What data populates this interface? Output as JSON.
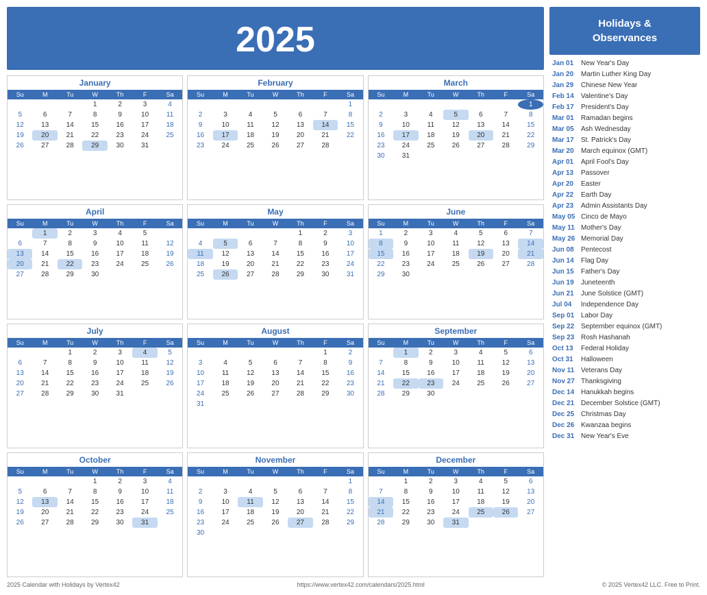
{
  "year": "2025",
  "footer": {
    "left": "2025 Calendar with Holidays by Vertex42",
    "center": "https://www.vertex42.com/calendars/2025.html",
    "right": "© 2025 Vertex42 LLC. Free to Print."
  },
  "holidays_title": "Holidays &\nObservances",
  "holidays": [
    {
      "date": "Jan 01",
      "name": "New Year's Day"
    },
    {
      "date": "Jan 20",
      "name": "Martin Luther King Day"
    },
    {
      "date": "Jan 29",
      "name": "Chinese New Year"
    },
    {
      "date": "Feb 14",
      "name": "Valentine's Day"
    },
    {
      "date": "Feb 17",
      "name": "President's Day"
    },
    {
      "date": "Mar 01",
      "name": "Ramadan begins"
    },
    {
      "date": "Mar 05",
      "name": "Ash Wednesday"
    },
    {
      "date": "Mar 17",
      "name": "St. Patrick's Day"
    },
    {
      "date": "Mar 20",
      "name": "March equinox (GMT)"
    },
    {
      "date": "Apr 01",
      "name": "April Fool's Day"
    },
    {
      "date": "Apr 13",
      "name": "Passover"
    },
    {
      "date": "Apr 20",
      "name": "Easter"
    },
    {
      "date": "Apr 22",
      "name": "Earth Day"
    },
    {
      "date": "Apr 23",
      "name": "Admin Assistants Day"
    },
    {
      "date": "May 05",
      "name": "Cinco de Mayo"
    },
    {
      "date": "May 11",
      "name": "Mother's Day"
    },
    {
      "date": "May 26",
      "name": "Memorial Day"
    },
    {
      "date": "Jun 08",
      "name": "Pentecost"
    },
    {
      "date": "Jun 14",
      "name": "Flag Day"
    },
    {
      "date": "Jun 15",
      "name": "Father's Day"
    },
    {
      "date": "Jun 19",
      "name": "Juneteenth"
    },
    {
      "date": "Jun 21",
      "name": "June Solstice (GMT)"
    },
    {
      "date": "Jul 04",
      "name": "Independence Day"
    },
    {
      "date": "Sep 01",
      "name": "Labor Day"
    },
    {
      "date": "Sep 22",
      "name": "September equinox (GMT)"
    },
    {
      "date": "Sep 23",
      "name": "Rosh Hashanah"
    },
    {
      "date": "Oct 13",
      "name": "Federal Holiday"
    },
    {
      "date": "Oct 31",
      "name": "Halloween"
    },
    {
      "date": "Nov 11",
      "name": "Veterans Day"
    },
    {
      "date": "Nov 27",
      "name": "Thanksgiving"
    },
    {
      "date": "Dec 14",
      "name": "Hanukkah begins"
    },
    {
      "date": "Dec 21",
      "name": "December Solstice (GMT)"
    },
    {
      "date": "Dec 25",
      "name": "Christmas Day"
    },
    {
      "date": "Dec 26",
      "name": "Kwanzaa begins"
    },
    {
      "date": "Dec 31",
      "name": "New Year's Eve"
    }
  ],
  "months": [
    {
      "name": "January",
      "weeks": [
        [
          "",
          "",
          "",
          "1",
          "2",
          "3",
          "4"
        ],
        [
          "5",
          "6",
          "7",
          "8",
          "9",
          "10",
          "11"
        ],
        [
          "12",
          "13",
          "14",
          "15",
          "16",
          "17",
          "18"
        ],
        [
          "19",
          "20",
          "21",
          "22",
          "23",
          "24",
          "25"
        ],
        [
          "26",
          "27",
          "28",
          "29",
          "30",
          "31",
          ""
        ]
      ],
      "highlights": {
        "20": "mlk",
        "29": "cny"
      },
      "today": ""
    },
    {
      "name": "February",
      "weeks": [
        [
          "",
          "",
          "",
          "",
          "",
          "",
          "1"
        ],
        [
          "2",
          "3",
          "4",
          "5",
          "6",
          "7",
          "8"
        ],
        [
          "9",
          "10",
          "11",
          "12",
          "13",
          "14",
          "15"
        ],
        [
          "16",
          "17",
          "18",
          "19",
          "20",
          "21",
          "22"
        ],
        [
          "23",
          "24",
          "25",
          "26",
          "27",
          "28",
          ""
        ]
      ],
      "highlights": {
        "14": "valentine",
        "17": "pres"
      },
      "today": ""
    },
    {
      "name": "March",
      "weeks": [
        [
          "",
          "",
          "",
          "",
          "",
          "",
          "1"
        ],
        [
          "2",
          "3",
          "4",
          "5",
          "6",
          "7",
          "8"
        ],
        [
          "9",
          "10",
          "11",
          "12",
          "13",
          "14",
          "15"
        ],
        [
          "16",
          "17",
          "18",
          "19",
          "20",
          "21",
          "22"
        ],
        [
          "23",
          "24",
          "25",
          "26",
          "27",
          "28",
          "29"
        ],
        [
          "30",
          "31",
          "",
          "",
          "",
          "",
          ""
        ]
      ],
      "highlights": {
        "5": "ash",
        "17": "patrick",
        "20": "equinox"
      },
      "today": "1"
    },
    {
      "name": "April",
      "weeks": [
        [
          "",
          "1",
          "2",
          "3",
          "4",
          "5",
          ""
        ],
        [
          "6",
          "7",
          "8",
          "9",
          "10",
          "11",
          "12"
        ],
        [
          "13",
          "14",
          "15",
          "16",
          "17",
          "18",
          "19"
        ],
        [
          "20",
          "21",
          "22",
          "23",
          "24",
          "25",
          "26"
        ],
        [
          "27",
          "28",
          "29",
          "30",
          "",
          "",
          ""
        ]
      ],
      "highlights": {
        "1": "fool",
        "13": "passover",
        "20": "easter",
        "22": "earth"
      },
      "today": ""
    },
    {
      "name": "May",
      "weeks": [
        [
          "",
          "",
          "",
          "",
          "1",
          "2",
          "3"
        ],
        [
          "4",
          "5",
          "6",
          "7",
          "8",
          "9",
          "10"
        ],
        [
          "11",
          "12",
          "13",
          "14",
          "15",
          "16",
          "17"
        ],
        [
          "18",
          "19",
          "20",
          "21",
          "22",
          "23",
          "24"
        ],
        [
          "25",
          "26",
          "27",
          "28",
          "29",
          "30",
          "31"
        ]
      ],
      "highlights": {
        "5": "cinco",
        "11": "mothers",
        "26": "memorial"
      },
      "today": ""
    },
    {
      "name": "June",
      "weeks": [
        [
          "1",
          "2",
          "3",
          "4",
          "5",
          "6",
          "7"
        ],
        [
          "8",
          "9",
          "10",
          "11",
          "12",
          "13",
          "14"
        ],
        [
          "15",
          "16",
          "17",
          "18",
          "19",
          "20",
          "21"
        ],
        [
          "22",
          "23",
          "24",
          "25",
          "26",
          "27",
          "28"
        ],
        [
          "29",
          "30",
          "",
          "",
          "",
          "",
          ""
        ]
      ],
      "highlights": {
        "8": "pent",
        "14": "flag",
        "15": "fathers",
        "19": "june",
        "21": "solstice"
      },
      "today": ""
    },
    {
      "name": "July",
      "weeks": [
        [
          "",
          "",
          "1",
          "2",
          "3",
          "4",
          "5"
        ],
        [
          "6",
          "7",
          "8",
          "9",
          "10",
          "11",
          "12"
        ],
        [
          "13",
          "14",
          "15",
          "16",
          "17",
          "18",
          "19"
        ],
        [
          "20",
          "21",
          "22",
          "23",
          "24",
          "25",
          "26"
        ],
        [
          "27",
          "28",
          "29",
          "30",
          "31",
          "",
          ""
        ]
      ],
      "highlights": {
        "4": "july4"
      },
      "today": ""
    },
    {
      "name": "August",
      "weeks": [
        [
          "",
          "",
          "",
          "",
          "",
          "1",
          "2"
        ],
        [
          "3",
          "4",
          "5",
          "6",
          "7",
          "8",
          "9"
        ],
        [
          "10",
          "11",
          "12",
          "13",
          "14",
          "15",
          "16"
        ],
        [
          "17",
          "18",
          "19",
          "20",
          "21",
          "22",
          "23"
        ],
        [
          "24",
          "25",
          "26",
          "27",
          "28",
          "29",
          "30"
        ],
        [
          "31",
          "",
          "",
          "",
          "",
          "",
          ""
        ]
      ],
      "highlights": {},
      "today": ""
    },
    {
      "name": "September",
      "weeks": [
        [
          "",
          "1",
          "2",
          "3",
          "4",
          "5",
          "6"
        ],
        [
          "7",
          "8",
          "9",
          "10",
          "11",
          "12",
          "13"
        ],
        [
          "14",
          "15",
          "16",
          "17",
          "18",
          "19",
          "20"
        ],
        [
          "21",
          "22",
          "23",
          "24",
          "25",
          "26",
          "27"
        ],
        [
          "28",
          "29",
          "30",
          "",
          "",
          "",
          ""
        ]
      ],
      "highlights": {
        "1": "labor",
        "22": "sept-eq",
        "23": "rosh"
      },
      "today": ""
    },
    {
      "name": "October",
      "weeks": [
        [
          "",
          "",
          "",
          "1",
          "2",
          "3",
          "4"
        ],
        [
          "5",
          "6",
          "7",
          "8",
          "9",
          "10",
          "11"
        ],
        [
          "12",
          "13",
          "14",
          "15",
          "16",
          "17",
          "18"
        ],
        [
          "19",
          "20",
          "21",
          "22",
          "23",
          "24",
          "25"
        ],
        [
          "26",
          "27",
          "28",
          "29",
          "30",
          "31",
          ""
        ]
      ],
      "highlights": {
        "13": "federal",
        "31": "halloween"
      },
      "today": ""
    },
    {
      "name": "November",
      "weeks": [
        [
          "",
          "",
          "",
          "",
          "",
          "",
          "1"
        ],
        [
          "2",
          "3",
          "4",
          "5",
          "6",
          "7",
          "8"
        ],
        [
          "9",
          "10",
          "11",
          "12",
          "13",
          "14",
          "15"
        ],
        [
          "16",
          "17",
          "18",
          "19",
          "20",
          "21",
          "22"
        ],
        [
          "23",
          "24",
          "25",
          "26",
          "27",
          "28",
          "29"
        ],
        [
          "30",
          "",
          "",
          "",
          "",
          "",
          ""
        ]
      ],
      "highlights": {
        "11": "veterans",
        "27": "thanksgiving"
      },
      "today": ""
    },
    {
      "name": "December",
      "weeks": [
        [
          "",
          "1",
          "2",
          "3",
          "4",
          "5",
          "6"
        ],
        [
          "7",
          "8",
          "9",
          "10",
          "11",
          "12",
          "13"
        ],
        [
          "14",
          "15",
          "16",
          "17",
          "18",
          "19",
          "20"
        ],
        [
          "21",
          "22",
          "23",
          "24",
          "25",
          "26",
          "27"
        ],
        [
          "28",
          "29",
          "30",
          "31",
          "",
          "",
          ""
        ]
      ],
      "highlights": {
        "14": "hanukkah",
        "21": "dec-sol",
        "25": "christmas",
        "26": "kwanzaa",
        "31": "nye"
      },
      "today": ""
    }
  ],
  "days_header": [
    "Su",
    "M",
    "Tu",
    "W",
    "Th",
    "F",
    "Sa"
  ]
}
